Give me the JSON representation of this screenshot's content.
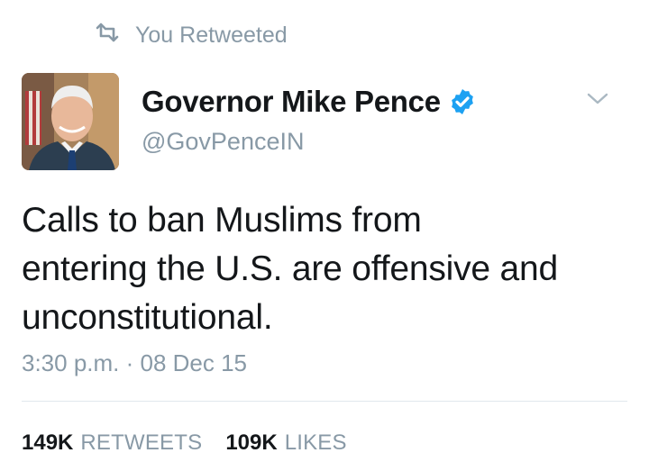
{
  "retweet_context": {
    "icon": "retweet-icon",
    "label": "You Retweeted"
  },
  "author": {
    "display_name": "Governor Mike Pence",
    "handle": "@GovPenceIN",
    "verified": true,
    "verified_icon": "verified-badge-icon",
    "avatar": "avatar"
  },
  "menu": {
    "icon": "chevron-down-icon"
  },
  "tweet": {
    "line1": "Calls to ban Muslims from",
    "line2": "entering the U.S. are offensive and",
    "line3": "unconstitutional."
  },
  "timestamp": "3:30 p.m. · 08 Dec 15",
  "stats": {
    "retweets_count": "149K",
    "retweets_label": "RETWEETS",
    "likes_count": "109K",
    "likes_label": "LIKES"
  },
  "colors": {
    "text": "#14171a",
    "muted": "#8899a6",
    "verified": "#1da1f2",
    "divider": "#e1e8ed"
  }
}
